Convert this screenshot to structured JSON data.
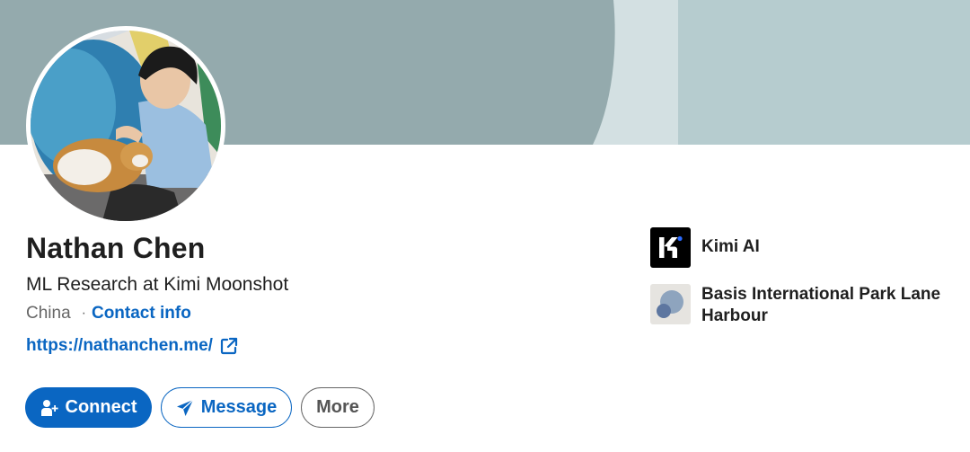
{
  "profile": {
    "name": "Nathan Chen",
    "headline": "ML Research at Kimi Moonshot",
    "location": "China",
    "separator": "·",
    "contact_label": "Contact info",
    "website": "https://nathanchen.me/"
  },
  "actions": {
    "connect_label": "Connect",
    "message_label": "Message",
    "more_label": "More"
  },
  "organizations": [
    {
      "name": "Kimi AI",
      "logo": "kimi-logo"
    },
    {
      "name": "Basis International Park Lane Harbour",
      "logo": "basis-logo"
    }
  ],
  "colors": {
    "accent": "#0a66c2",
    "banner": "#b6cccf",
    "text": "#1f1f1f",
    "muted": "#666666"
  }
}
